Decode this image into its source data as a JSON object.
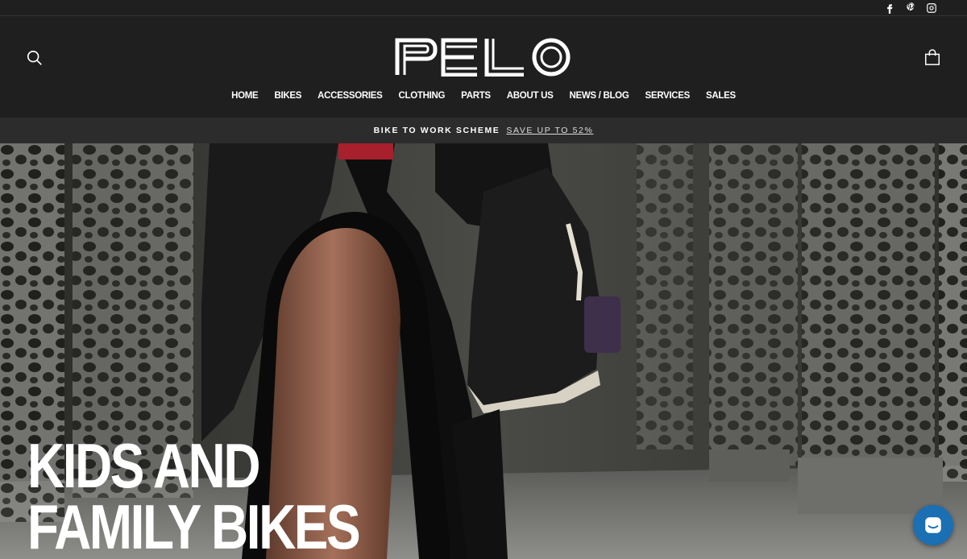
{
  "brand": {
    "logo_text": "PELO"
  },
  "social": [
    {
      "name": "facebook-icon"
    },
    {
      "name": "pinterest-icon"
    },
    {
      "name": "instagram-icon"
    }
  ],
  "nav": {
    "items": [
      {
        "label": "HOME"
      },
      {
        "label": "BIKES"
      },
      {
        "label": "ACCESSORIES"
      },
      {
        "label": "CLOTHING"
      },
      {
        "label": "PARTS"
      },
      {
        "label": "ABOUT US"
      },
      {
        "label": "NEWS / BLOG"
      },
      {
        "label": "SERVICES"
      },
      {
        "label": "SALES"
      }
    ]
  },
  "announcement": {
    "text": "BIKE TO WORK SCHEME",
    "link": "SAVE UP TO 52%"
  },
  "hero": {
    "title_line1": "KIDS AND",
    "title_line2": "FAMILY BIKES"
  },
  "colors": {
    "header_bg": "#1e1f1e",
    "announce_bg": "#2c2c2c",
    "chat_bg": "#1b6fb3"
  }
}
